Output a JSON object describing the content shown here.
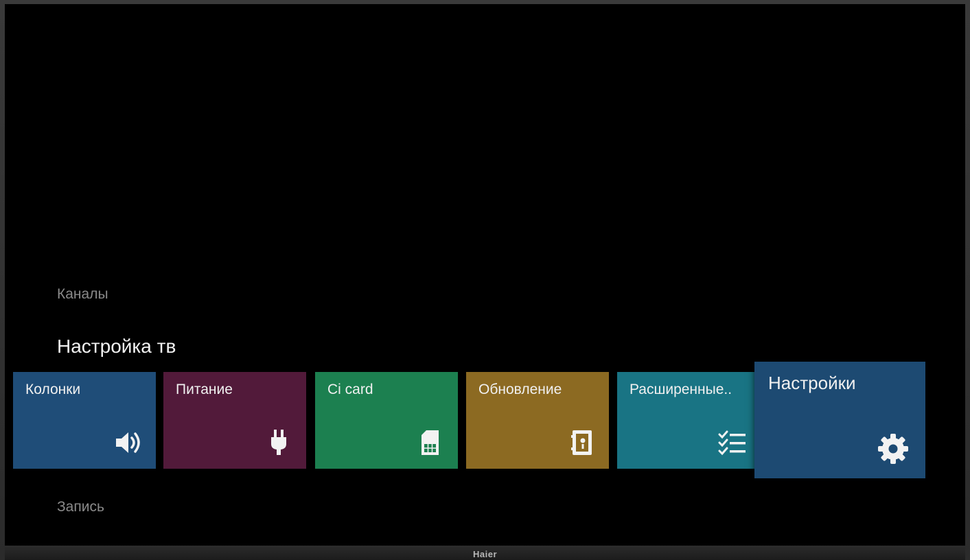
{
  "brand": "Haier",
  "rows": {
    "previous": "Каналы",
    "current": "Настройка тв",
    "next": "Запись"
  },
  "tiles": [
    {
      "label": "Колонки",
      "icon": "speaker-icon",
      "color": "#1f4d78"
    },
    {
      "label": "Питание",
      "icon": "power-plug-icon",
      "color": "#521a3a"
    },
    {
      "label": "Ci card",
      "icon": "sim-card-icon",
      "color": "#1c8050"
    },
    {
      "label": "Обновление",
      "icon": "update-document-icon",
      "color": "#8c6a22"
    },
    {
      "label": "Расширенные..",
      "icon": "checklist-icon",
      "color": "#197484"
    },
    {
      "label": "Настройки",
      "icon": "gear-icon",
      "color": "#1d4a72",
      "focused": true
    }
  ]
}
